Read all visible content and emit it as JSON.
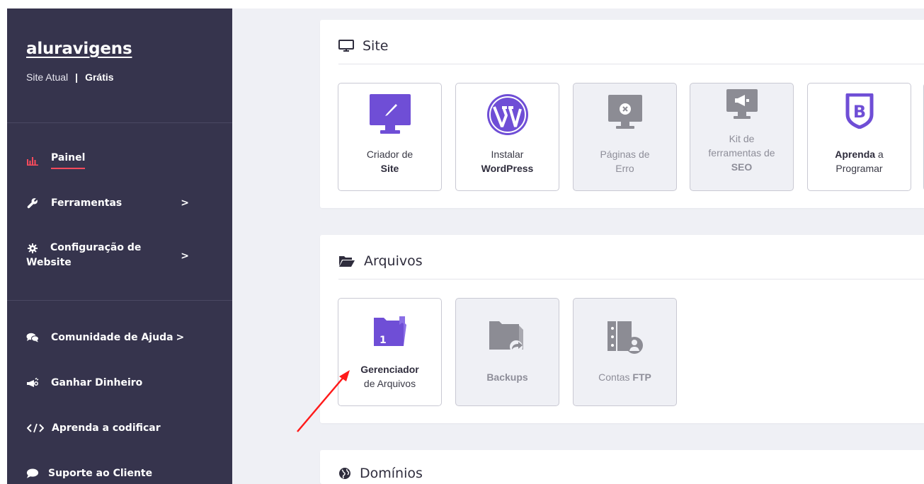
{
  "sidebar": {
    "brand": "aluravigens",
    "site_label": "Site Atual",
    "separator": "|",
    "plan": "Grátis",
    "items": [
      {
        "label": "Painel"
      },
      {
        "label": "Ferramentas"
      },
      {
        "label_line1": "Configuração de",
        "label_line2": "Website"
      },
      {
        "label": "Comunidade de Ajuda"
      },
      {
        "label": "Ganhar Dinheiro"
      },
      {
        "label": "Aprenda a codificar"
      },
      {
        "label": "Suporte ao Cliente"
      }
    ],
    "chevron": ">"
  },
  "sections": {
    "site": {
      "title": "Site",
      "tiles": [
        {
          "line1": "Criador de",
          "line2_bold": "Site"
        },
        {
          "line1": "Instalar",
          "line2_bold": "WordPress"
        },
        {
          "line1": "Páginas de",
          "line2": "Erro"
        },
        {
          "line1": "Kit de",
          "line2": "ferramentas de",
          "line3": "SEO"
        },
        {
          "bold": "Aprenda",
          "rest": " a",
          "line2": "Programar"
        }
      ]
    },
    "arquivos": {
      "title": "Arquivos",
      "tiles": [
        {
          "line1_bold": "Gerenciador",
          "line2": "de Arquivos",
          "badge": "1"
        },
        {
          "bold": "Backups"
        },
        {
          "prefix": "Contas ",
          "bold": "FTP"
        }
      ]
    },
    "dominios": {
      "title": "Domínios"
    }
  },
  "colors": {
    "sidebar_bg": "#36344d",
    "accent_red": "#ff4b5c",
    "purple": "#6f4ed6",
    "disabled_icon": "#8c8c94",
    "main_bg": "#eff0f5"
  },
  "icons": {
    "painel": "bar-chart-icon",
    "ferramentas": "wrench-icon",
    "configuracao": "gear-icon",
    "comunidade": "chat-bubbles-icon",
    "ganhar": "megaphone-icon",
    "aprenda": "code-icon",
    "suporte": "speech-bubble-icon"
  }
}
